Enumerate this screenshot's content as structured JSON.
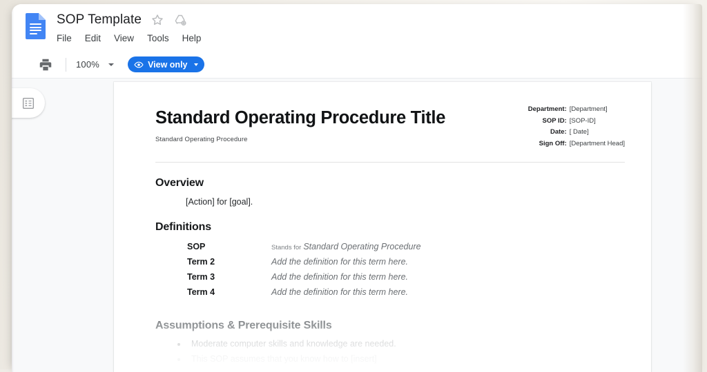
{
  "app": {
    "icon_name": "google-docs-icon",
    "doc_title": "SOP Template",
    "star_icon": "star-icon",
    "drive_icon": "add-to-drive-icon",
    "menu": [
      "File",
      "Edit",
      "View",
      "Tools",
      "Help"
    ]
  },
  "toolbar": {
    "print_icon": "print-icon",
    "zoom_level": "100%",
    "zoom_caret": "chevron-down-icon",
    "view_mode_label": "View only",
    "view_mode_icon": "eye-icon",
    "view_mode_caret": "chevron-down-icon",
    "accent_color": "#1a73e8"
  },
  "workspace": {
    "outline_icon": "document-outline-icon"
  },
  "document": {
    "title": "Standard Operating Procedure Title",
    "subtitle": "Standard Operating Procedure",
    "meta": [
      {
        "key": "Department:",
        "value": "[Department]"
      },
      {
        "key": "SOP ID:",
        "value": "[SOP-ID]"
      },
      {
        "key": "Date:",
        "value": "[ Date]"
      },
      {
        "key": "Sign Off:",
        "value": "[Department Head]"
      }
    ],
    "overview": {
      "heading": "Overview",
      "body": "[Action] for [goal]."
    },
    "definitions": {
      "heading": "Definitions",
      "rows": [
        {
          "term": "SOP",
          "prefix": "Stands for",
          "desc": "Standard Operating Procedure"
        },
        {
          "term": "Term 2",
          "prefix": "",
          "desc": "Add the definition for this term here."
        },
        {
          "term": "Term 3",
          "prefix": "",
          "desc": "Add the definition for this term here."
        },
        {
          "term": "Term 4",
          "prefix": "",
          "desc": "Add the definition for this term here."
        }
      ]
    },
    "assumptions": {
      "heading": "Assumptions & Prerequisite Skills",
      "items": [
        "Moderate computer skills and knowledge are needed.",
        "This SOP assumes that you know how to [insert]"
      ]
    }
  }
}
